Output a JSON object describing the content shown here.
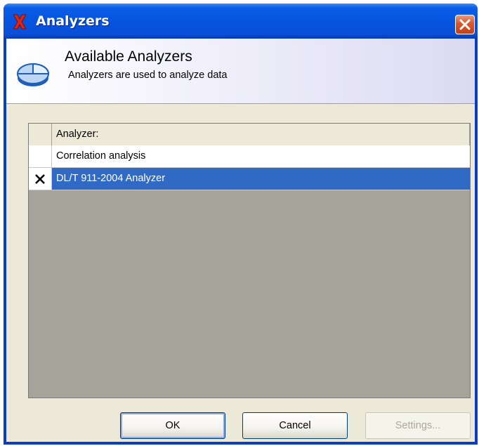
{
  "window": {
    "title": "Analyzers",
    "app_icon": "red-x-icon",
    "close_icon": "close-icon"
  },
  "header": {
    "title": "Available Analyzers",
    "subtitle": "Analyzers are used to analyze data",
    "icon": "pie-chart-icon"
  },
  "grid": {
    "column_header": "Analyzer:",
    "rows": [
      {
        "label": "Correlation analysis",
        "checked": false,
        "selected": false
      },
      {
        "label": "DL/T 911-2004 Analyzer",
        "checked": true,
        "selected": true
      }
    ]
  },
  "buttons": {
    "ok": "OK",
    "cancel": "Cancel",
    "settings": "Settings..."
  },
  "colors": {
    "titlebar": "#0454e0",
    "selection": "#316ac5",
    "empty_grid": "#a6a39a",
    "close_button": "#d5582e"
  }
}
